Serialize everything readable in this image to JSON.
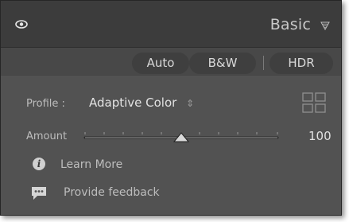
{
  "header": {
    "eye_icon": "eye-icon",
    "title": "Basic",
    "collapse_icon": "triangle-down-icon"
  },
  "treatment_buttons": {
    "auto": "Auto",
    "bw": "B&W",
    "hdr": "HDR"
  },
  "profile": {
    "label": "Profile :",
    "value": "Adaptive Color",
    "browse_icon": "grid-icon"
  },
  "amount": {
    "label": "Amount",
    "value": "100",
    "slider_fraction": 0.5
  },
  "links": {
    "learn_more": "Learn More",
    "feedback": "Provide feedback"
  },
  "colors": {
    "panel_bg": "#525252",
    "header_bg": "#3c3c3c",
    "text": "#bdbdbd"
  }
}
